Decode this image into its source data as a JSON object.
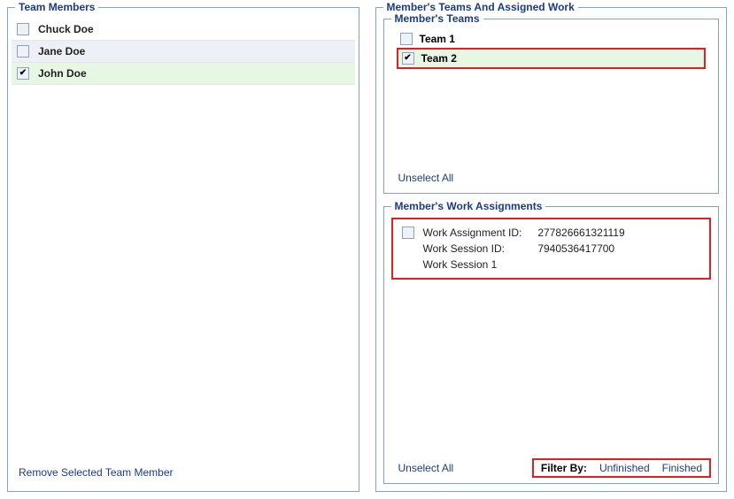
{
  "left": {
    "title": "Team Members",
    "rows": [
      {
        "name": "Chuck Doe",
        "checked": false,
        "selected": false
      },
      {
        "name": "Jane Doe",
        "checked": false,
        "selected": false
      },
      {
        "name": "John Doe",
        "checked": true,
        "selected": true
      }
    ],
    "removeLabel": "Remove Selected Team Member"
  },
  "right": {
    "title": "Member's Teams And Assigned Work",
    "teams": {
      "title": "Member's Teams",
      "rows": [
        {
          "name": "Team 1",
          "checked": false,
          "selected": false,
          "boxed": false
        },
        {
          "name": "Team 2",
          "checked": true,
          "selected": true,
          "boxed": true
        }
      ],
      "unselectLabel": "Unselect All"
    },
    "work": {
      "title": "Member's Work Assignments",
      "assignment": {
        "idLabel": "Work Assignment ID:",
        "idValue": "277826661321119",
        "sessionIdLabel": "Work Session ID:",
        "sessionIdValue": "7940536417700",
        "sessionName": "Work Session 1",
        "checked": false
      },
      "unselectLabel": "Unselect All",
      "filterLabel": "Filter By:",
      "filterOptions": [
        "Unfinished",
        "Finished"
      ]
    }
  }
}
